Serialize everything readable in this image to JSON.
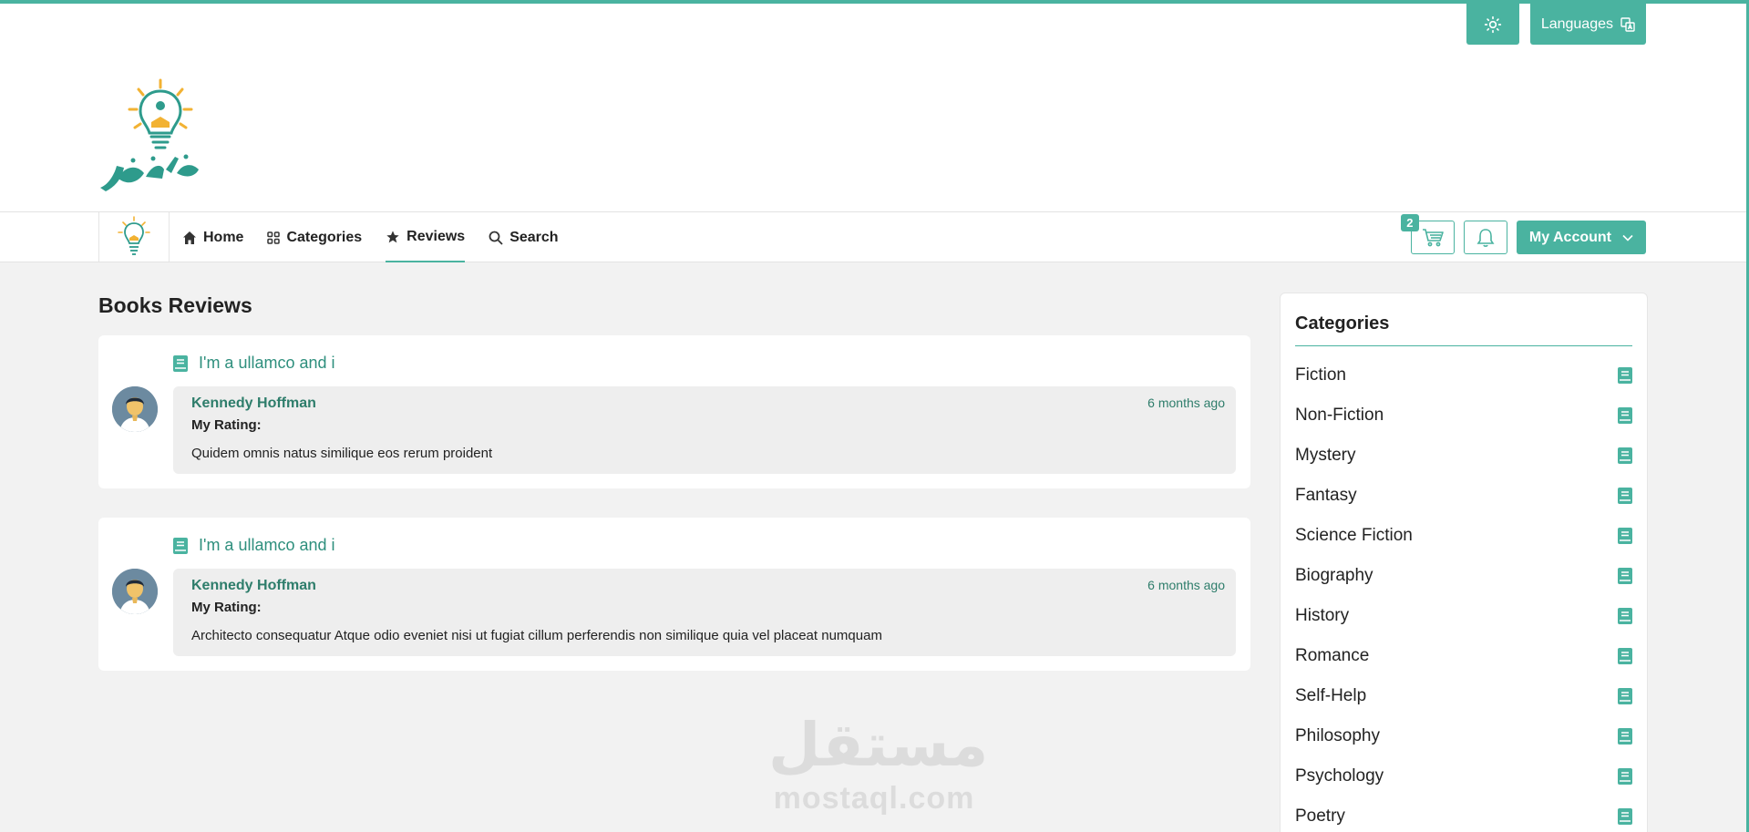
{
  "header": {
    "languages_label": "Languages",
    "logo_text": "مكتبة نور"
  },
  "nav": {
    "items": [
      {
        "label": "Home",
        "icon": "home-icon"
      },
      {
        "label": "Categories",
        "icon": "grid-icon"
      },
      {
        "label": "Reviews",
        "icon": "star-icon",
        "active": true
      },
      {
        "label": "Search",
        "icon": "search-icon"
      }
    ],
    "cart_count": "2",
    "account_label": "My Account"
  },
  "page": {
    "title": "Books Reviews"
  },
  "reviews": [
    {
      "book_title": "I'm a ullamco and i",
      "reviewer": "Kennedy Hoffman",
      "time_ago": "6 months ago",
      "rating_label": "My Rating:",
      "text": "Quidem omnis natus similique eos rerum proident"
    },
    {
      "book_title": "I'm a ullamco and i",
      "reviewer": "Kennedy Hoffman",
      "time_ago": "6 months ago",
      "rating_label": "My Rating:",
      "text": "Architecto consequatur Atque odio eveniet nisi ut fugiat cillum perferendis non similique quia vel placeat numquam"
    }
  ],
  "sidebar": {
    "title": "Categories",
    "categories": [
      "Fiction",
      "Non-Fiction",
      "Mystery",
      "Fantasy",
      "Science Fiction",
      "Biography",
      "History",
      "Romance",
      "Self-Help",
      "Philosophy",
      "Psychology",
      "Poetry"
    ]
  },
  "watermark": {
    "arabic": "مستقل",
    "latin": "mostaql.com"
  },
  "colors": {
    "accent": "#4ab3a0",
    "accent_text": "#2e8f7d"
  }
}
